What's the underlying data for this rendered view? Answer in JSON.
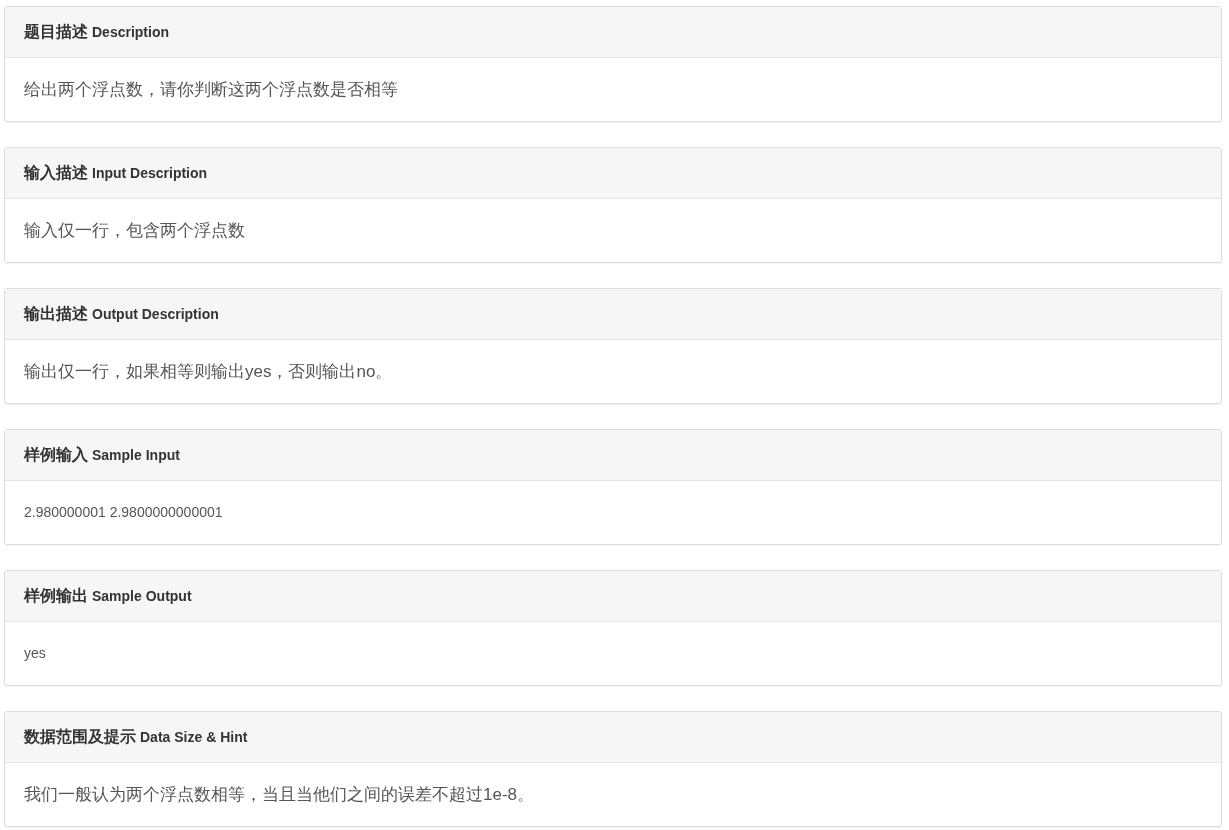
{
  "panels": [
    {
      "title": "题目描述",
      "subtitle": "Description",
      "kind": "text",
      "body": "给出两个浮点数，请你判断这两个浮点数是否相等"
    },
    {
      "title": "输入描述",
      "subtitle": "Input Description",
      "kind": "text",
      "body": "输入仅一行，包含两个浮点数"
    },
    {
      "title": "输出描述",
      "subtitle": "Output Description",
      "kind": "text",
      "body": "输出仅一行，如果相等则输出yes，否则输出no。"
    },
    {
      "title": "样例输入",
      "subtitle": "Sample Input",
      "kind": "sample",
      "body": "2.980000001 2.9800000000001"
    },
    {
      "title": "样例输出",
      "subtitle": "Sample Output",
      "kind": "sample",
      "body": "yes"
    },
    {
      "title": "数据范围及提示",
      "subtitle": "Data Size & Hint",
      "kind": "text",
      "body": "我们一般认为两个浮点数相等，当且当他们之间的误差不超过1e-8。"
    }
  ]
}
